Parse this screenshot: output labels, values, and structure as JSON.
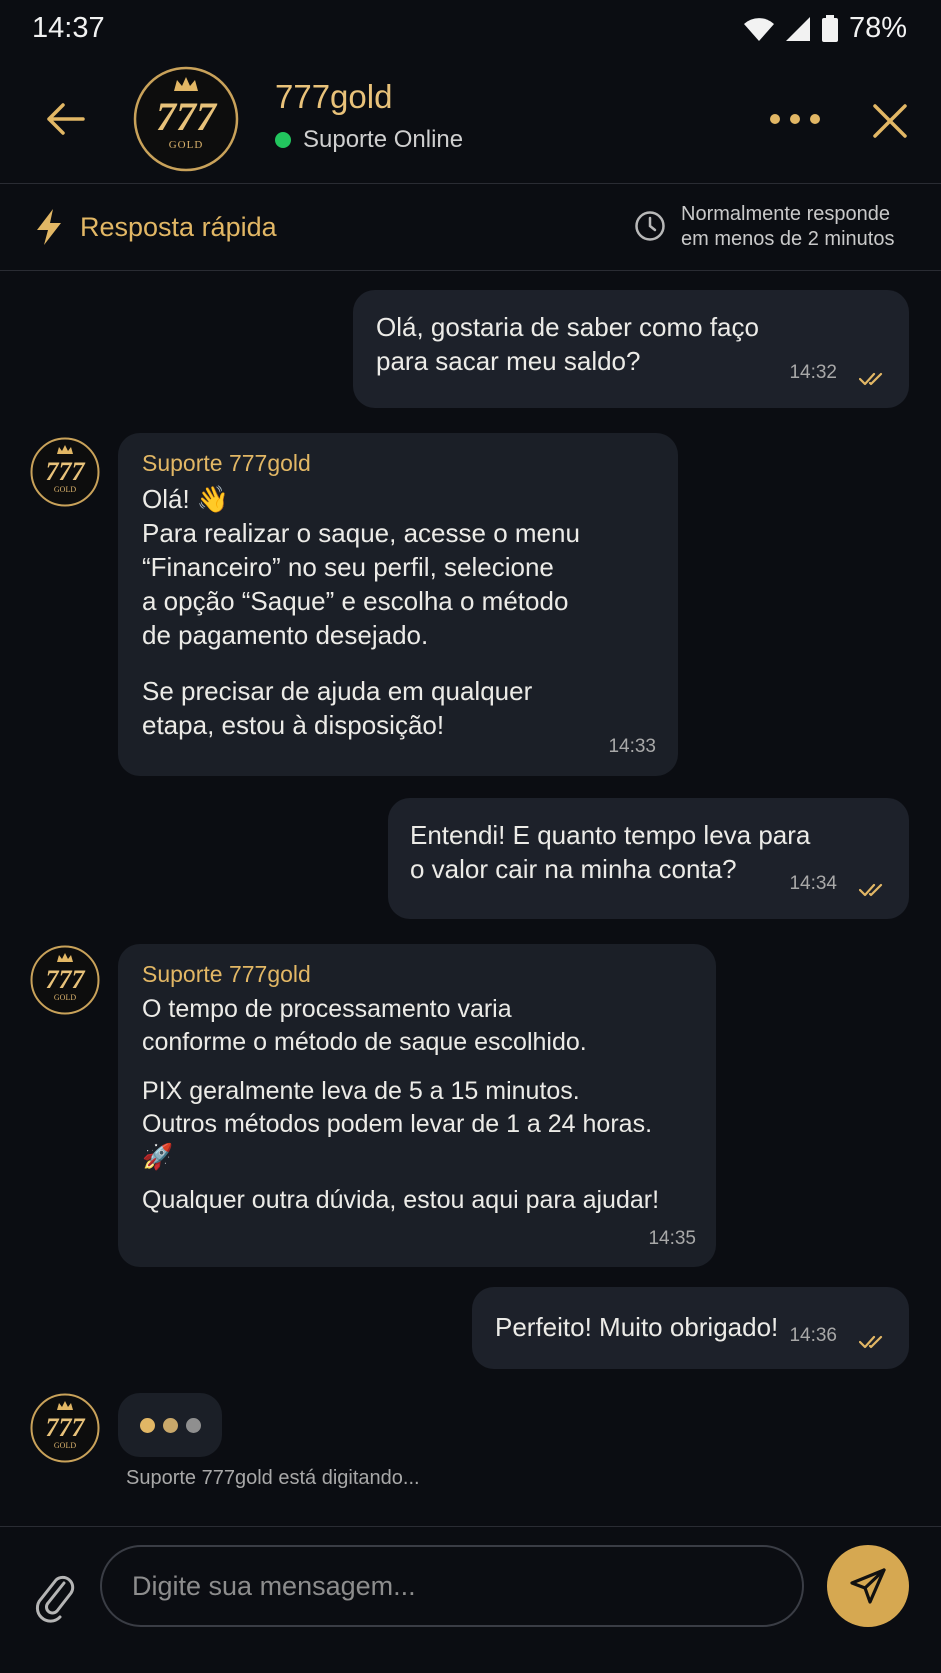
{
  "status_bar": {
    "time": "14:37",
    "battery": "78%"
  },
  "header": {
    "title": "777gold",
    "status": "Suporte Online",
    "avatar": {
      "number": "777",
      "word": "GOLD"
    }
  },
  "subbar": {
    "quick_label": "Resposta rápida",
    "response_line1": "Normalmente responde",
    "response_line2": "em menos de 2 minutos"
  },
  "messages": [
    {
      "lines": [
        "Olá, gostaria de saber como faço",
        "para sacar meu saldo?"
      ],
      "time": "14:32"
    },
    {
      "sender": "Suporte 777gold",
      "p1": [
        "Olá! 👋",
        "Para realizar o saque, acesse o menu",
        "“Financeiro” no seu perfil, selecione",
        "a opção “Saque” e escolha o método",
        "de pagamento desejado."
      ],
      "p2": [
        "Se precisar de ajuda em qualquer",
        "etapa, estou à disposição!"
      ],
      "time": "14:33"
    },
    {
      "lines": [
        "Entendi! E quanto tempo leva para",
        "o valor cair na minha conta?"
      ],
      "time": "14:34"
    },
    {
      "sender": "Suporte 777gold",
      "p1": [
        "O tempo de processamento varia",
        "conforme o método de saque escolhido."
      ],
      "p2": [
        "PIX geralmente leva de 5 a 15 minutos.",
        "Outros métodos podem levar de 1 a 24 horas.",
        "🚀"
      ],
      "p3": [
        "Qualquer outra dúvida, estou aqui para ajudar!"
      ],
      "time": "14:35"
    },
    {
      "lines": [
        "Perfeito! Muito obrigado!"
      ],
      "time": "14:36"
    }
  ],
  "typing": {
    "text": "Suporte 777gold está digitando..."
  },
  "composer": {
    "placeholder": "Digite sua mensagem..."
  },
  "colors": {
    "accent": "#e2b765",
    "online": "#22c55e",
    "background": "#0b0d12",
    "bubble": "#1b1f27"
  }
}
